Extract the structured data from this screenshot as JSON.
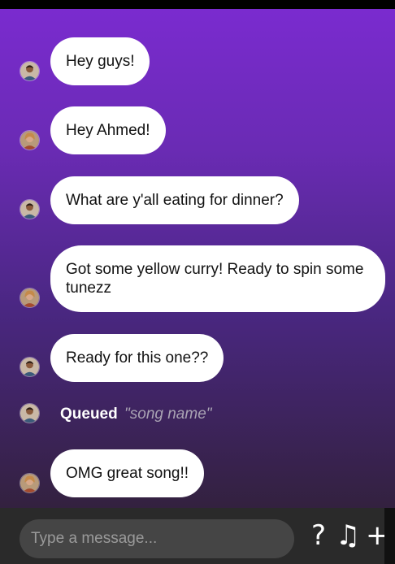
{
  "messages": [
    {
      "type": "message",
      "user": "ahmed",
      "text": "Hey guys!"
    },
    {
      "type": "message",
      "user": "friend",
      "text": "Hey Ahmed!"
    },
    {
      "type": "message",
      "user": "ahmed",
      "text": "What are y'all eating for dinner?"
    },
    {
      "type": "message",
      "user": "friend",
      "text": "Got some yellow curry! Ready to spin some tunezz"
    },
    {
      "type": "message",
      "user": "ahmed",
      "text": "Ready for this one??"
    },
    {
      "type": "queue",
      "user": "ahmed",
      "label": "Queued",
      "song": "\"song name\""
    },
    {
      "type": "message",
      "user": "friend",
      "text": "OMG great song!!"
    }
  ],
  "composer": {
    "placeholder": "Type a message...",
    "help_label": "?",
    "music_label": "♫",
    "add_label": "+"
  },
  "icons": {
    "help": "question-icon",
    "music": "music-note-icon",
    "add": "plus-icon"
  },
  "colors": {
    "gradient_top": "#7a2bcf",
    "gradient_bottom": "#33213f",
    "bubble": "#ffffff",
    "composer_bg": "#2a2a2a",
    "input_bg": "#454545"
  }
}
